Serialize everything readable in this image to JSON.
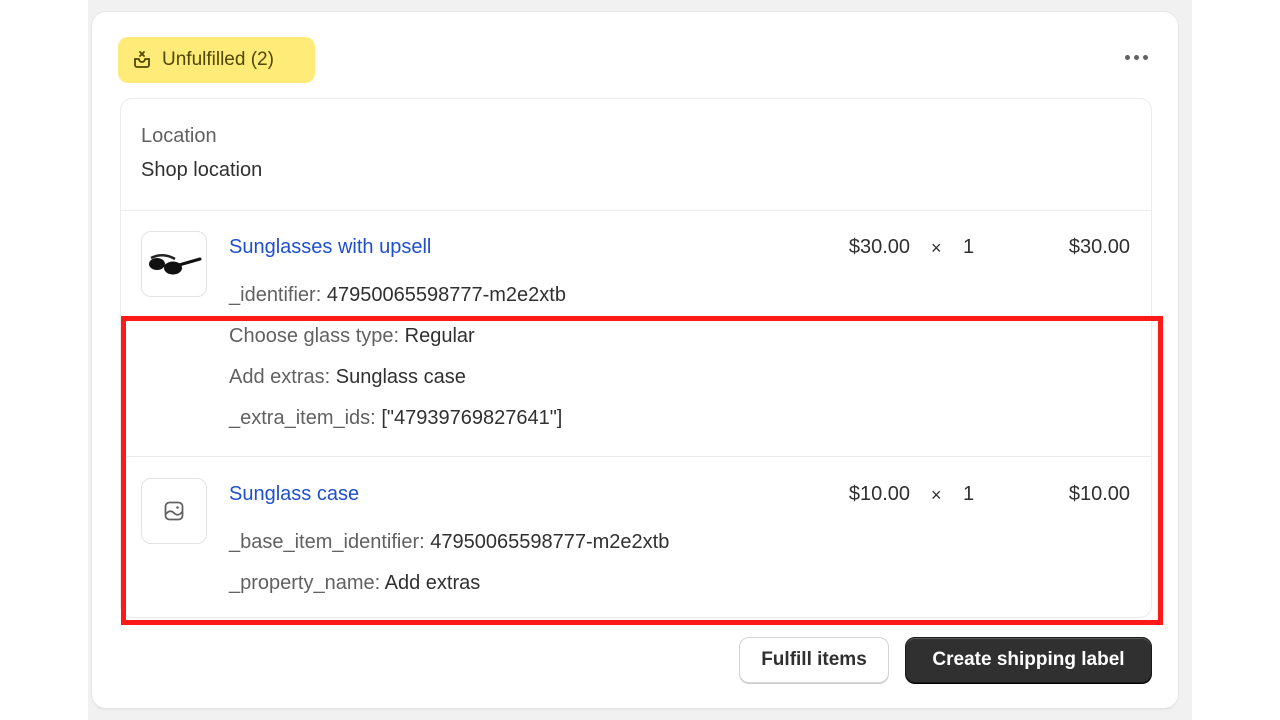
{
  "status_badge": {
    "label": "Unfulfilled (2)",
    "icon": "unfulfilled-box-icon",
    "color": "#ffeb78"
  },
  "more_actions": {
    "icon": "more-horizontal-icon"
  },
  "location": {
    "label": "Location",
    "value": "Shop location"
  },
  "line_items": [
    {
      "title": "Sunglasses with upsell",
      "thumbnail": "sunglasses-product-image",
      "unit_price": "$30.00",
      "times": "×",
      "quantity": "1",
      "total": "$30.00",
      "properties": [
        {
          "key": "_identifier:",
          "value": "47950065598777-m2e2xtb"
        },
        {
          "key": "Choose glass type:",
          "value": "Regular"
        },
        {
          "key": "Add extras:",
          "value": "Sunglass case"
        },
        {
          "key": "_extra_item_ids:",
          "value": "[\"47939769827641\"]"
        }
      ]
    },
    {
      "title": "Sunglass case",
      "thumbnail": "image-placeholder-icon",
      "unit_price": "$10.00",
      "times": "×",
      "quantity": "1",
      "total": "$10.00",
      "properties": [
        {
          "key": "_base_item_identifier:",
          "value": "47950065598777-m2e2xtb"
        },
        {
          "key": "_property_name:",
          "value": "Add extras"
        }
      ]
    }
  ],
  "highlight_color": "#ff1a1a",
  "actions": {
    "fulfill_label": "Fulfill items",
    "shipping_label": "Create shipping label"
  }
}
